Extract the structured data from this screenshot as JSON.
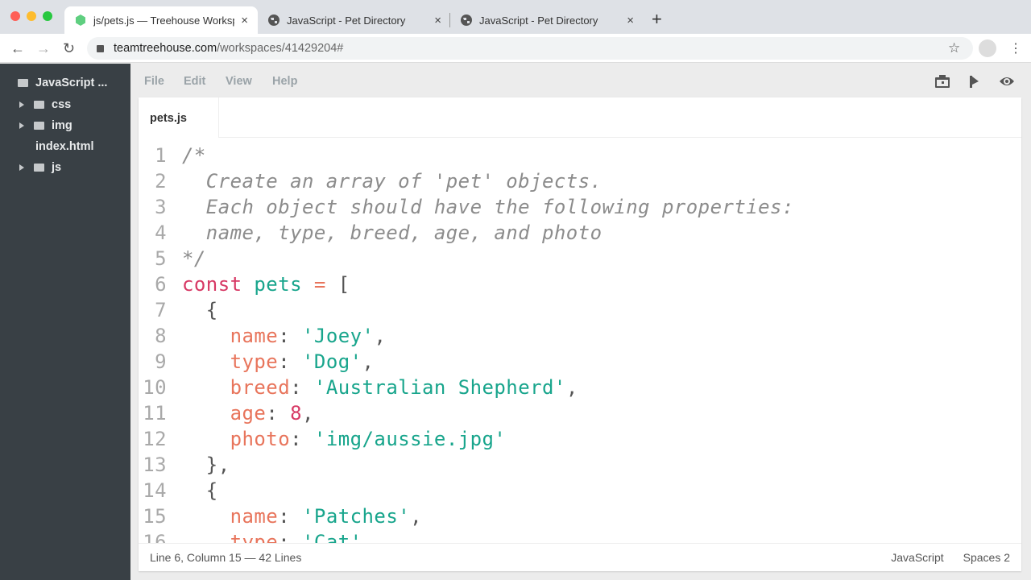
{
  "browser": {
    "tabs": [
      {
        "title": "js/pets.js — Treehouse Workspaces",
        "icon": "treehouse-icon",
        "active": true
      },
      {
        "title": "JavaScript - Pet Directory",
        "icon": "globe-icon"
      },
      {
        "title": "JavaScript - Pet Directory",
        "icon": "globe-icon"
      }
    ],
    "new_tab": "+",
    "close": "×",
    "url_host": "teamtreehouse.com",
    "url_path": "/workspaces/41429204#"
  },
  "sidebar": {
    "items": [
      {
        "label": "JavaScript ...",
        "type": "root"
      },
      {
        "label": "css",
        "type": "folder"
      },
      {
        "label": "img",
        "type": "folder"
      },
      {
        "label": "index.html",
        "type": "file"
      },
      {
        "label": "js",
        "type": "folder"
      }
    ]
  },
  "menu": {
    "items": [
      "File",
      "Edit",
      "View",
      "Help"
    ]
  },
  "editor": {
    "file_tab": "pets.js",
    "lines": [
      [
        [
          "cm",
          "/*"
        ]
      ],
      [
        [
          "cm",
          "  Create an array of 'pet' objects."
        ]
      ],
      [
        [
          "cm",
          "  Each object should have the following properties:"
        ]
      ],
      [
        [
          "cm",
          "  name, type, breed, age, and photo"
        ]
      ],
      [
        [
          "cm",
          "*/"
        ]
      ],
      [
        [
          "kw",
          "const"
        ],
        [
          "pn",
          " "
        ],
        [
          "id",
          "pets"
        ],
        [
          "pn",
          " "
        ],
        [
          "op",
          "="
        ],
        [
          "pn",
          " ["
        ]
      ],
      [
        [
          "pn",
          "  {"
        ]
      ],
      [
        [
          "pn",
          "    "
        ],
        [
          "prop",
          "name"
        ],
        [
          "pn",
          ": "
        ],
        [
          "str",
          "'Joey'"
        ],
        [
          "pn",
          ","
        ]
      ],
      [
        [
          "pn",
          "    "
        ],
        [
          "prop",
          "type"
        ],
        [
          "pn",
          ": "
        ],
        [
          "str",
          "'Dog'"
        ],
        [
          "pn",
          ","
        ]
      ],
      [
        [
          "pn",
          "    "
        ],
        [
          "prop",
          "breed"
        ],
        [
          "pn",
          ": "
        ],
        [
          "str",
          "'Australian Shepherd'"
        ],
        [
          "pn",
          ","
        ]
      ],
      [
        [
          "pn",
          "    "
        ],
        [
          "prop",
          "age"
        ],
        [
          "pn",
          ": "
        ],
        [
          "nm",
          "8"
        ],
        [
          "pn",
          ","
        ]
      ],
      [
        [
          "pn",
          "    "
        ],
        [
          "prop",
          "photo"
        ],
        [
          "pn",
          ": "
        ],
        [
          "str",
          "'img/aussie.jpg'"
        ]
      ],
      [
        [
          "pn",
          "  },"
        ]
      ],
      [
        [
          "pn",
          "  {"
        ]
      ],
      [
        [
          "pn",
          "    "
        ],
        [
          "prop",
          "name"
        ],
        [
          "pn",
          ": "
        ],
        [
          "str",
          "'Patches'"
        ],
        [
          "pn",
          ","
        ]
      ],
      [
        [
          "pn",
          "    "
        ],
        [
          "prop",
          "type"
        ],
        [
          "pn",
          ": "
        ],
        [
          "str",
          "'Cat'"
        ],
        [
          "pn",
          ","
        ]
      ]
    ]
  },
  "status": {
    "position": "Line 6, Column 15 — 42 Lines",
    "language": "JavaScript",
    "indent": "Spaces 2"
  },
  "colors": {
    "keyword": "#d73864",
    "string": "#18a58c",
    "property": "#e8755c",
    "comment": "#8c8c8c",
    "sidebar": "#394045"
  }
}
